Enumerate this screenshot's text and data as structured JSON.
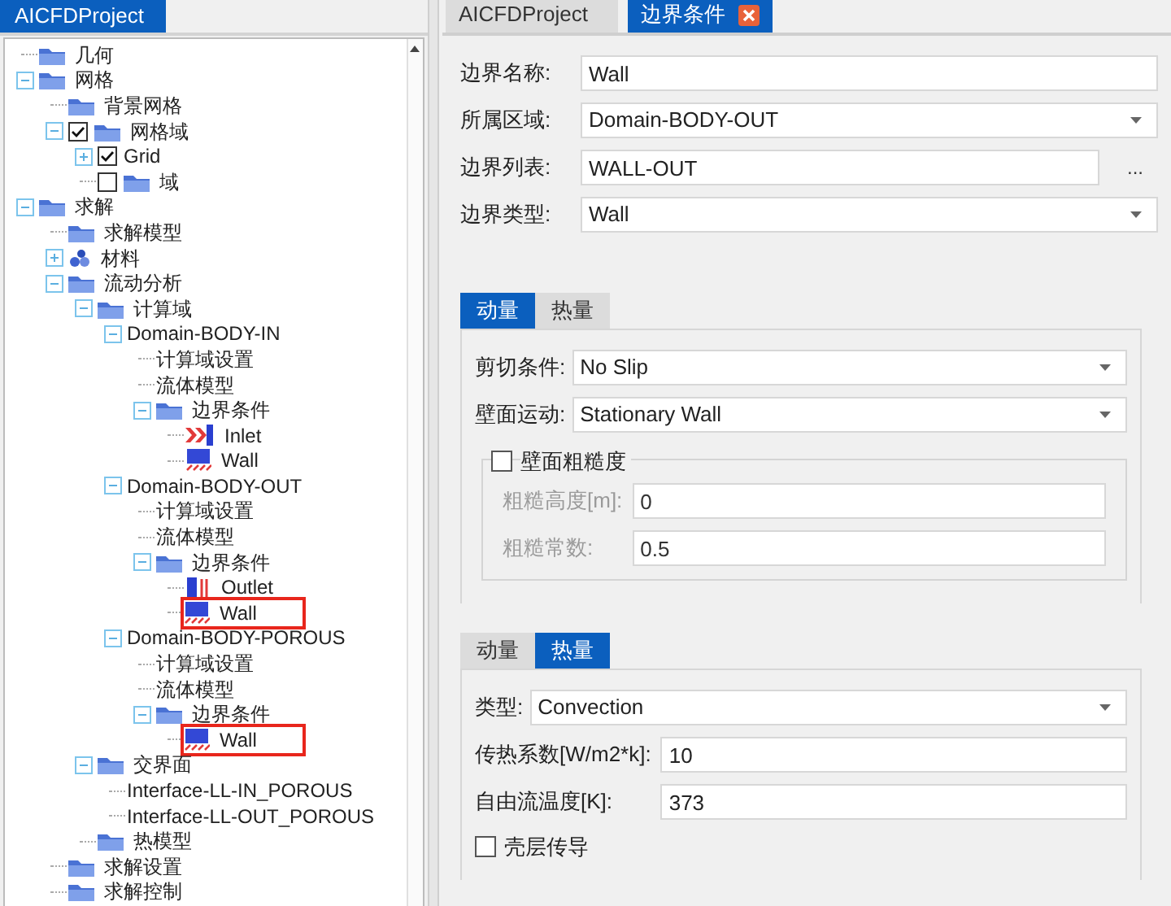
{
  "left_panel": {
    "tab": "AICFDProject",
    "tree": [
      {
        "label": "几何",
        "kind": "folder"
      },
      {
        "label": "网格",
        "kind": "folder",
        "expanded": true,
        "children": [
          {
            "label": "背景网格",
            "kind": "folder"
          },
          {
            "label": "网格域",
            "kind": "folder",
            "expanded": true,
            "checked": true,
            "children": [
              {
                "label": "Grid",
                "expanded": false,
                "checked": true
              },
              {
                "label": "域",
                "kind": "folder",
                "checked": false
              }
            ]
          }
        ]
      },
      {
        "label": "求解",
        "kind": "folder",
        "expanded": true,
        "children": [
          {
            "label": "求解模型",
            "kind": "folder"
          },
          {
            "label": "材料",
            "kind": "material",
            "expanded": false
          },
          {
            "label": "流动分析",
            "kind": "folder",
            "expanded": true,
            "children": [
              {
                "label": "计算域",
                "kind": "folder",
                "expanded": true,
                "children": [
                  {
                    "label": "Domain-BODY-IN",
                    "expanded": true,
                    "children": [
                      {
                        "label": "计算域设置"
                      },
                      {
                        "label": "流体模型"
                      },
                      {
                        "label": "边界条件",
                        "kind": "folder",
                        "expanded": true,
                        "children": [
                          {
                            "label": "Inlet",
                            "kind": "inlet",
                            "highlighted": false
                          },
                          {
                            "label": "Wall",
                            "kind": "wall",
                            "highlighted": false
                          }
                        ]
                      }
                    ]
                  },
                  {
                    "label": "Domain-BODY-OUT",
                    "expanded": true,
                    "children": [
                      {
                        "label": "计算域设置"
                      },
                      {
                        "label": "流体模型"
                      },
                      {
                        "label": "边界条件",
                        "kind": "folder",
                        "expanded": true,
                        "children": [
                          {
                            "label": "Outlet",
                            "kind": "outlet",
                            "highlighted": false
                          },
                          {
                            "label": "Wall",
                            "kind": "wall",
                            "highlighted": true
                          }
                        ]
                      }
                    ]
                  },
                  {
                    "label": "Domain-BODY-POROUS",
                    "expanded": true,
                    "children": [
                      {
                        "label": "计算域设置"
                      },
                      {
                        "label": "流体模型"
                      },
                      {
                        "label": "边界条件",
                        "kind": "folder",
                        "expanded": true,
                        "children": [
                          {
                            "label": "Wall",
                            "kind": "wall",
                            "highlighted": true
                          }
                        ]
                      }
                    ]
                  }
                ]
              },
              {
                "label": "交界面",
                "kind": "folder",
                "expanded": true,
                "children": [
                  {
                    "label": "Interface-LL-IN_POROUS"
                  },
                  {
                    "label": "Interface-LL-OUT_POROUS"
                  }
                ]
              },
              {
                "label": "热模型",
                "kind": "folder"
              }
            ]
          },
          {
            "label": "求解设置",
            "kind": "folder"
          },
          {
            "label": "求解控制",
            "kind": "folder"
          }
        ]
      }
    ]
  },
  "editor": {
    "tabs": [
      {
        "label": "AICFDProject",
        "selected": false,
        "closable": false
      },
      {
        "label": "边界条件",
        "selected": true,
        "closable": true
      }
    ],
    "fields": [
      {
        "kind": "text",
        "label": "边界名称:",
        "value": "Wall"
      },
      {
        "kind": "select",
        "label": "所属区域:",
        "value": "Domain-BODY-OUT"
      },
      {
        "kind": "browse",
        "label": "边界列表:",
        "value": "WALL-OUT",
        "button": "..."
      },
      {
        "kind": "select",
        "label": "边界类型:",
        "value": "Wall"
      }
    ],
    "sections": [
      {
        "tabs": [
          {
            "label": "动量",
            "selected": true
          },
          {
            "label": "热量",
            "selected": false
          }
        ],
        "rows": [
          {
            "kind": "select",
            "label": "剪切条件:",
            "value": "No Slip"
          },
          {
            "kind": "select",
            "label": "壁面运动:",
            "value": "Stationary Wall"
          },
          {
            "kind": "group",
            "label": "壁面粗糙度",
            "checked": false,
            "rows": [
              {
                "kind": "text",
                "label": "粗糙高度[m]:",
                "value": "0",
                "disabled": true
              },
              {
                "kind": "text",
                "label": "粗糙常数:",
                "value": "0.5",
                "disabled": true
              }
            ]
          }
        ]
      },
      {
        "tabs": [
          {
            "label": "动量",
            "selected": false
          },
          {
            "label": "热量",
            "selected": true
          }
        ],
        "rows": [
          {
            "kind": "select",
            "label": "类型:",
            "value": "Convection"
          },
          {
            "kind": "text",
            "label": "传热系数[W/m2*k]:",
            "value": "10",
            "disabled": false
          },
          {
            "kind": "text",
            "label": "自由流温度[K]:",
            "value": "373",
            "disabled": false
          },
          {
            "kind": "checkbox",
            "label": "壳层传导",
            "checked": false
          }
        ]
      }
    ]
  }
}
